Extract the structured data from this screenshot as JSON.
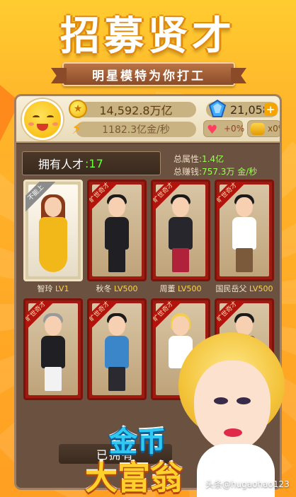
{
  "banner": {
    "title": "招募贤才",
    "subtitle": "明星模特为你打工"
  },
  "top_panel": {
    "money": "14,592.8万亿",
    "income": "1182.3亿金/秒",
    "diamonds": "21,058",
    "heart_boost": "+0%",
    "coin_boost": "x0%"
  },
  "talent": {
    "header_label": "拥有人才",
    "header_count": ":17",
    "attr_label": "总属性",
    "attr_value": ":1.4亿",
    "earn_label": "总赚钱",
    "earn_value": ":757.3万 金/秒"
  },
  "cards": [
    {
      "tag": "不能上",
      "name": "智玲",
      "level": "LV1",
      "owned": true
    },
    {
      "tag": "旷世奇才",
      "name": "秋冬",
      "level": "LV500",
      "owned": false
    },
    {
      "tag": "旷世奇才",
      "name": "周董",
      "level": "LV500",
      "owned": false
    },
    {
      "tag": "旷世奇才",
      "name": "国民岳父",
      "level": "LV500",
      "owned": false
    },
    {
      "tag": "旷世奇才",
      "name": "",
      "level": "",
      "owned": false
    },
    {
      "tag": "旷世奇才",
      "name": "",
      "level": "",
      "owned": false
    },
    {
      "tag": "旷世奇才",
      "name": "",
      "level": "",
      "owned": false
    },
    {
      "tag": "旷世奇才",
      "name": "",
      "level": "",
      "owned": false
    }
  ],
  "owned_button": "已拥有",
  "promo": {
    "line1": "金币",
    "line2": "大富翁"
  },
  "watermark": "头条@hugaohao123"
}
